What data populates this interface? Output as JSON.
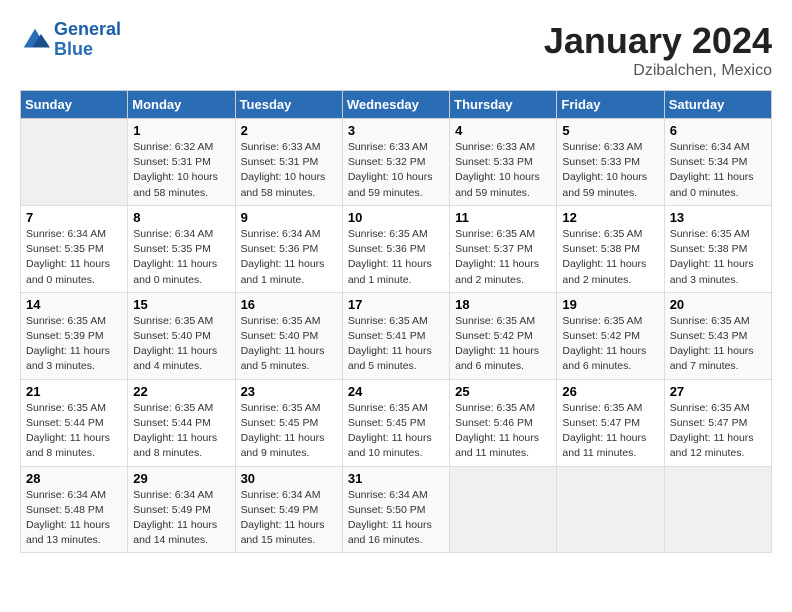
{
  "header": {
    "logo_general": "General",
    "logo_blue": "Blue",
    "month": "January 2024",
    "location": "Dzibalchen, Mexico"
  },
  "days_of_week": [
    "Sunday",
    "Monday",
    "Tuesday",
    "Wednesday",
    "Thursday",
    "Friday",
    "Saturday"
  ],
  "weeks": [
    [
      {
        "day": "",
        "info": ""
      },
      {
        "day": "1",
        "info": "Sunrise: 6:32 AM\nSunset: 5:31 PM\nDaylight: 10 hours\nand 58 minutes."
      },
      {
        "day": "2",
        "info": "Sunrise: 6:33 AM\nSunset: 5:31 PM\nDaylight: 10 hours\nand 58 minutes."
      },
      {
        "day": "3",
        "info": "Sunrise: 6:33 AM\nSunset: 5:32 PM\nDaylight: 10 hours\nand 59 minutes."
      },
      {
        "day": "4",
        "info": "Sunrise: 6:33 AM\nSunset: 5:33 PM\nDaylight: 10 hours\nand 59 minutes."
      },
      {
        "day": "5",
        "info": "Sunrise: 6:33 AM\nSunset: 5:33 PM\nDaylight: 10 hours\nand 59 minutes."
      },
      {
        "day": "6",
        "info": "Sunrise: 6:34 AM\nSunset: 5:34 PM\nDaylight: 11 hours\nand 0 minutes."
      }
    ],
    [
      {
        "day": "7",
        "info": "Sunrise: 6:34 AM\nSunset: 5:35 PM\nDaylight: 11 hours\nand 0 minutes."
      },
      {
        "day": "8",
        "info": "Sunrise: 6:34 AM\nSunset: 5:35 PM\nDaylight: 11 hours\nand 0 minutes."
      },
      {
        "day": "9",
        "info": "Sunrise: 6:34 AM\nSunset: 5:36 PM\nDaylight: 11 hours\nand 1 minute."
      },
      {
        "day": "10",
        "info": "Sunrise: 6:35 AM\nSunset: 5:36 PM\nDaylight: 11 hours\nand 1 minute."
      },
      {
        "day": "11",
        "info": "Sunrise: 6:35 AM\nSunset: 5:37 PM\nDaylight: 11 hours\nand 2 minutes."
      },
      {
        "day": "12",
        "info": "Sunrise: 6:35 AM\nSunset: 5:38 PM\nDaylight: 11 hours\nand 2 minutes."
      },
      {
        "day": "13",
        "info": "Sunrise: 6:35 AM\nSunset: 5:38 PM\nDaylight: 11 hours\nand 3 minutes."
      }
    ],
    [
      {
        "day": "14",
        "info": "Sunrise: 6:35 AM\nSunset: 5:39 PM\nDaylight: 11 hours\nand 3 minutes."
      },
      {
        "day": "15",
        "info": "Sunrise: 6:35 AM\nSunset: 5:40 PM\nDaylight: 11 hours\nand 4 minutes."
      },
      {
        "day": "16",
        "info": "Sunrise: 6:35 AM\nSunset: 5:40 PM\nDaylight: 11 hours\nand 5 minutes."
      },
      {
        "day": "17",
        "info": "Sunrise: 6:35 AM\nSunset: 5:41 PM\nDaylight: 11 hours\nand 5 minutes."
      },
      {
        "day": "18",
        "info": "Sunrise: 6:35 AM\nSunset: 5:42 PM\nDaylight: 11 hours\nand 6 minutes."
      },
      {
        "day": "19",
        "info": "Sunrise: 6:35 AM\nSunset: 5:42 PM\nDaylight: 11 hours\nand 6 minutes."
      },
      {
        "day": "20",
        "info": "Sunrise: 6:35 AM\nSunset: 5:43 PM\nDaylight: 11 hours\nand 7 minutes."
      }
    ],
    [
      {
        "day": "21",
        "info": "Sunrise: 6:35 AM\nSunset: 5:44 PM\nDaylight: 11 hours\nand 8 minutes."
      },
      {
        "day": "22",
        "info": "Sunrise: 6:35 AM\nSunset: 5:44 PM\nDaylight: 11 hours\nand 8 minutes."
      },
      {
        "day": "23",
        "info": "Sunrise: 6:35 AM\nSunset: 5:45 PM\nDaylight: 11 hours\nand 9 minutes."
      },
      {
        "day": "24",
        "info": "Sunrise: 6:35 AM\nSunset: 5:45 PM\nDaylight: 11 hours\nand 10 minutes."
      },
      {
        "day": "25",
        "info": "Sunrise: 6:35 AM\nSunset: 5:46 PM\nDaylight: 11 hours\nand 11 minutes."
      },
      {
        "day": "26",
        "info": "Sunrise: 6:35 AM\nSunset: 5:47 PM\nDaylight: 11 hours\nand 11 minutes."
      },
      {
        "day": "27",
        "info": "Sunrise: 6:35 AM\nSunset: 5:47 PM\nDaylight: 11 hours\nand 12 minutes."
      }
    ],
    [
      {
        "day": "28",
        "info": "Sunrise: 6:34 AM\nSunset: 5:48 PM\nDaylight: 11 hours\nand 13 minutes."
      },
      {
        "day": "29",
        "info": "Sunrise: 6:34 AM\nSunset: 5:49 PM\nDaylight: 11 hours\nand 14 minutes."
      },
      {
        "day": "30",
        "info": "Sunrise: 6:34 AM\nSunset: 5:49 PM\nDaylight: 11 hours\nand 15 minutes."
      },
      {
        "day": "31",
        "info": "Sunrise: 6:34 AM\nSunset: 5:50 PM\nDaylight: 11 hours\nand 16 minutes."
      },
      {
        "day": "",
        "info": ""
      },
      {
        "day": "",
        "info": ""
      },
      {
        "day": "",
        "info": ""
      }
    ]
  ]
}
